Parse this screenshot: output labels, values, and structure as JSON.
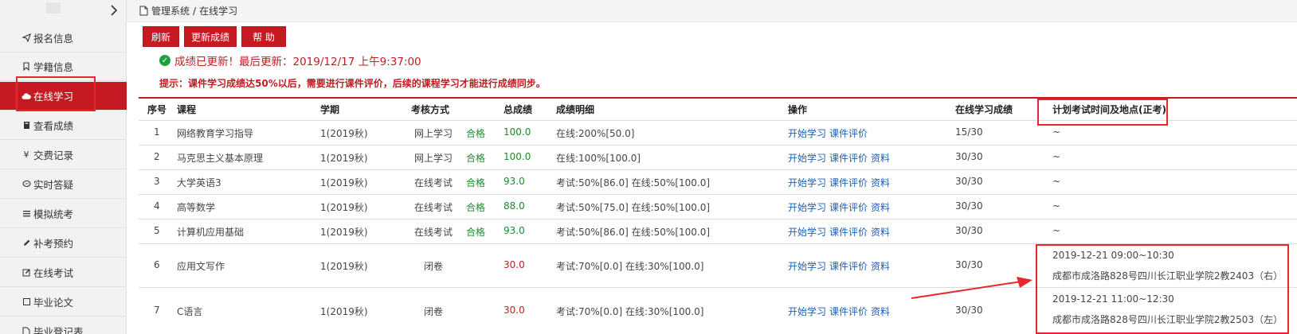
{
  "breadcrumb": {
    "root": "管理系统",
    "sep": "/",
    "current": "在线学习"
  },
  "sidebar": {
    "items": [
      {
        "label": "报名信息",
        "icon": "send-icon"
      },
      {
        "label": "学籍信息",
        "icon": "bookmark-icon"
      },
      {
        "label": "在线学习",
        "icon": "cloud-icon"
      },
      {
        "label": "查看成绩",
        "icon": "book-icon"
      },
      {
        "label": "交费记录",
        "icon": "yen-icon"
      },
      {
        "label": "实时答疑",
        "icon": "chat-icon"
      },
      {
        "label": "模拟统考",
        "icon": "list-icon"
      },
      {
        "label": "补考预约",
        "icon": "pencil-icon"
      },
      {
        "label": "在线考试",
        "icon": "edit-icon"
      },
      {
        "label": "毕业论文",
        "icon": "square-icon"
      },
      {
        "label": "毕业登记表",
        "icon": "doc-icon"
      }
    ]
  },
  "toolbar": {
    "refresh": "刷新",
    "update": "更新成绩",
    "help": "帮 助"
  },
  "status": {
    "text": "成绩已更新！最后更新：2019/12/17 上午9:37:00"
  },
  "tip": "提示：课件学习成绩达50%以后，需要进行课件评价，后续的课程学习才能进行成绩同步。",
  "table": {
    "headers": [
      "序号",
      "课程",
      "学期",
      "考核方式",
      "总成绩",
      "成绩明细",
      "操作",
      "在线学习成绩",
      "计划考试时间及地点(正考)"
    ],
    "rows": [
      {
        "no": "1",
        "course": "网络教育学习指导",
        "term": "1(2019秋)",
        "mode": "网上学习",
        "result": "合格",
        "score": "100.0",
        "detail": "在线:200%[50.0]",
        "actions": [
          "开始学习",
          "课件评价"
        ],
        "online": "15/30",
        "plan1": "~",
        "plan2": ""
      },
      {
        "no": "2",
        "course": "马克思主义基本原理",
        "term": "1(2019秋)",
        "mode": "网上学习",
        "result": "合格",
        "score": "100.0",
        "detail": "在线:100%[100.0]",
        "actions": [
          "开始学习",
          "课件评价",
          "资料"
        ],
        "online": "30/30",
        "plan1": "~",
        "plan2": ""
      },
      {
        "no": "3",
        "course": "大学英语3",
        "term": "1(2019秋)",
        "mode": "在线考试",
        "result": "合格",
        "score": "93.0",
        "detail": "考试:50%[86.0] 在线:50%[100.0]",
        "actions": [
          "开始学习",
          "课件评价",
          "资料"
        ],
        "online": "30/30",
        "plan1": "~",
        "plan2": ""
      },
      {
        "no": "4",
        "course": "高等数学",
        "term": "1(2019秋)",
        "mode": "在线考试",
        "result": "合格",
        "score": "88.0",
        "detail": "考试:50%[75.0] 在线:50%[100.0]",
        "actions": [
          "开始学习",
          "课件评价",
          "资料"
        ],
        "online": "30/30",
        "plan1": "~",
        "plan2": ""
      },
      {
        "no": "5",
        "course": "计算机应用基础",
        "term": "1(2019秋)",
        "mode": "在线考试",
        "result": "合格",
        "score": "93.0",
        "detail": "考试:50%[86.0] 在线:50%[100.0]",
        "actions": [
          "开始学习",
          "课件评价",
          "资料"
        ],
        "online": "30/30",
        "plan1": "~",
        "plan2": ""
      },
      {
        "no": "6",
        "course": "应用文写作",
        "term": "1(2019秋)",
        "mode": "闭卷",
        "result": "",
        "score": "30.0",
        "detail": "考试:70%[0.0] 在线:30%[100.0]",
        "actions": [
          "开始学习",
          "课件评价",
          "资料"
        ],
        "online": "30/30",
        "plan1": "2019-12-21 09:00~10:30",
        "plan2": "成都市成洛路828号四川长江职业学院2教2403（右）"
      },
      {
        "no": "7",
        "course": "C语言",
        "term": "1(2019秋)",
        "mode": "闭卷",
        "result": "",
        "score": "30.0",
        "detail": "考试:70%[0.0] 在线:30%[100.0]",
        "actions": [
          "开始学习",
          "课件评价",
          "资料"
        ],
        "online": "30/30",
        "plan1": "2019-12-21 11:00~12:30",
        "plan2": "成都市成洛路828号四川长江职业学院2教2503（左）"
      }
    ]
  },
  "colors": {
    "accent": "#c51a22",
    "pass": "#1a8c2e",
    "link": "#1e5fb4",
    "annotation": "#e8262d"
  }
}
